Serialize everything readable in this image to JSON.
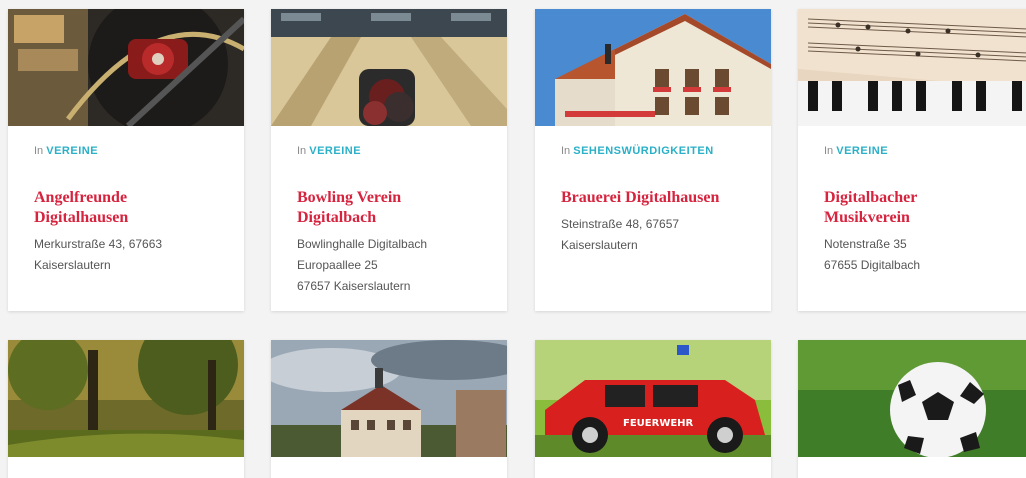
{
  "cards": [
    {
      "image": "fishing-reel-image",
      "category_prefix": "In",
      "category": "VEREINE",
      "title_lines": [
        "Angelfreunde",
        "Digitalhausen"
      ],
      "address_lines": [
        "Merkurstraße 43, 67663",
        "Kaiserslautern"
      ]
    },
    {
      "image": "bowling-alley-image",
      "category_prefix": "In",
      "category": "VEREINE",
      "title_lines": [
        "Bowling Verein",
        "Digitalbach"
      ],
      "address_lines": [
        "Bowlinghalle Digitalbach",
        "Europaallee 25",
        "67657 Kaiserslautern"
      ]
    },
    {
      "image": "brewery-building-image",
      "category_prefix": "In",
      "category": "SEHENSWÜRDIGKEITEN",
      "title_lines": [
        "Brauerei Digitalhausen"
      ],
      "address_lines": [
        "Steinstraße 48, 67657",
        "Kaiserslautern"
      ]
    },
    {
      "image": "sheet-music-piano-image",
      "category_prefix": "In",
      "category": "VEREINE",
      "title_lines": [
        "Digitalbacher",
        "Musikverein"
      ],
      "address_lines": [
        "Notenstraße 35",
        "67655 Digitalbach"
      ]
    },
    {
      "image": "forest-park-image"
    },
    {
      "image": "town-buildings-image"
    },
    {
      "image": "fire-brigade-toy-car-image",
      "car_text": "FEUERWEHR"
    },
    {
      "image": "soccer-ball-image"
    }
  ],
  "colors": {
    "accent_red": "#d6243f",
    "category_teal": "#2ab0c7"
  }
}
